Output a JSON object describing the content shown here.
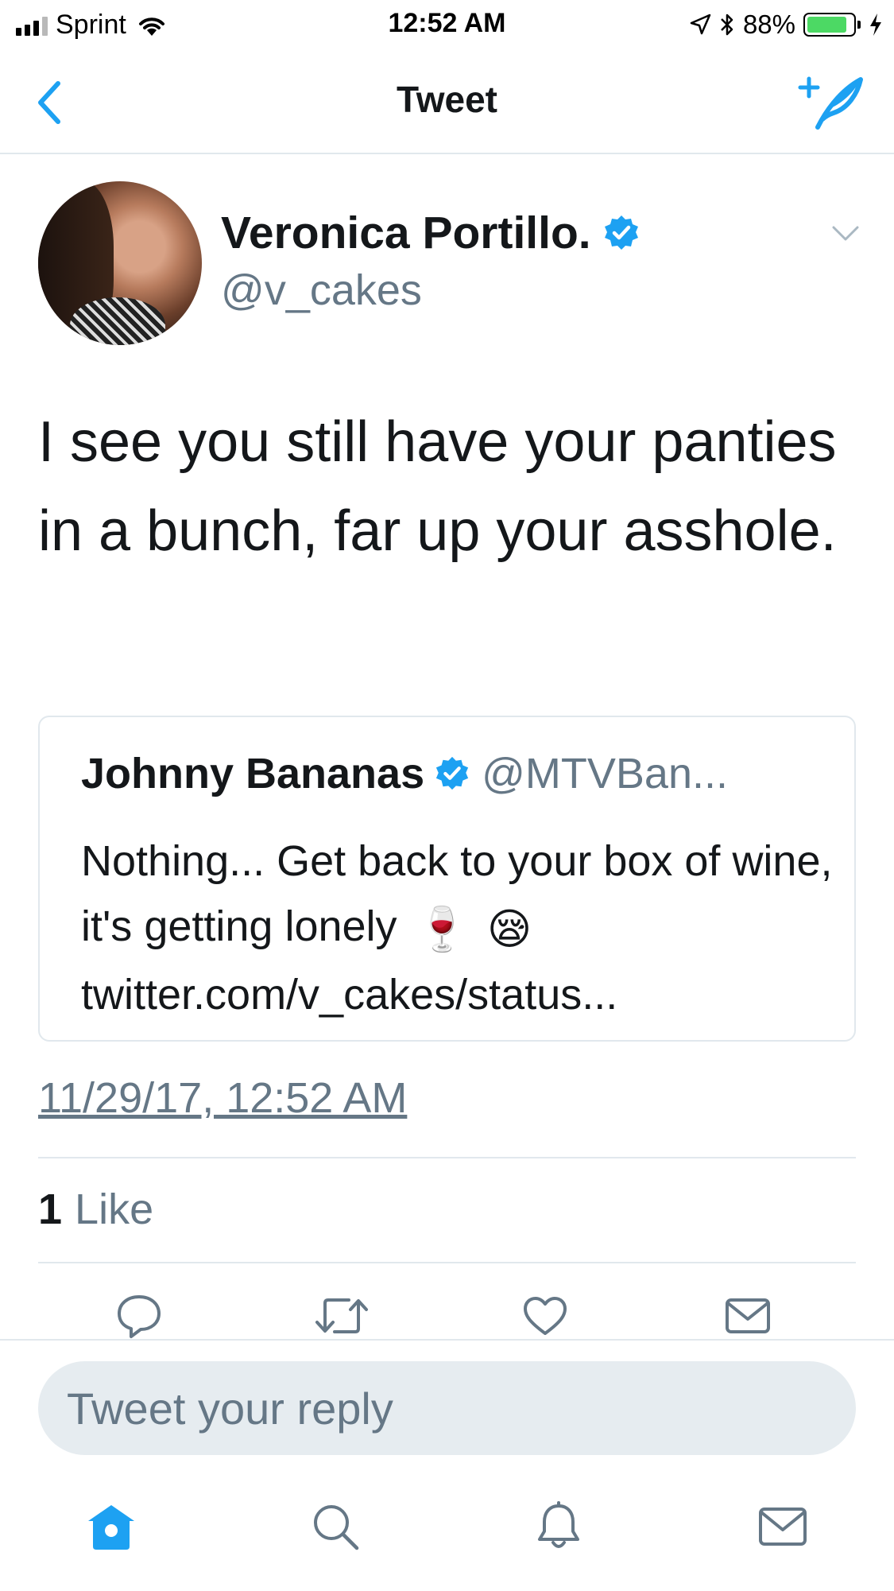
{
  "status_bar": {
    "carrier": "Sprint",
    "time": "12:52 AM",
    "battery_percent": "88%",
    "battery_level": 0.88
  },
  "nav": {
    "title": "Tweet",
    "accent_color": "#1da1f2"
  },
  "tweet": {
    "author_name": "Veronica Portillo.",
    "author_handle": "@v_cakes",
    "text": "I see you still have your panties in a bunch, far up your asshole.",
    "timestamp": "11/29/17, 12:52 AM",
    "likes_count": "1",
    "likes_label": "Like"
  },
  "quoted_tweet": {
    "author_name": "Johnny Bananas",
    "author_handle": "@MTVBan...",
    "text": "Nothing... Get back to your box of wine, it's getting lonely",
    "emojis": [
      "🍷",
      "😪"
    ],
    "link": "twitter.com/v_cakes/status..."
  },
  "reply": {
    "placeholder": "Tweet your reply"
  },
  "icons": {
    "actions": [
      "reply-icon",
      "retweet-icon",
      "like-icon",
      "share-icon"
    ],
    "tabs": [
      "home-icon",
      "search-icon",
      "notifications-icon",
      "messages-icon"
    ]
  }
}
